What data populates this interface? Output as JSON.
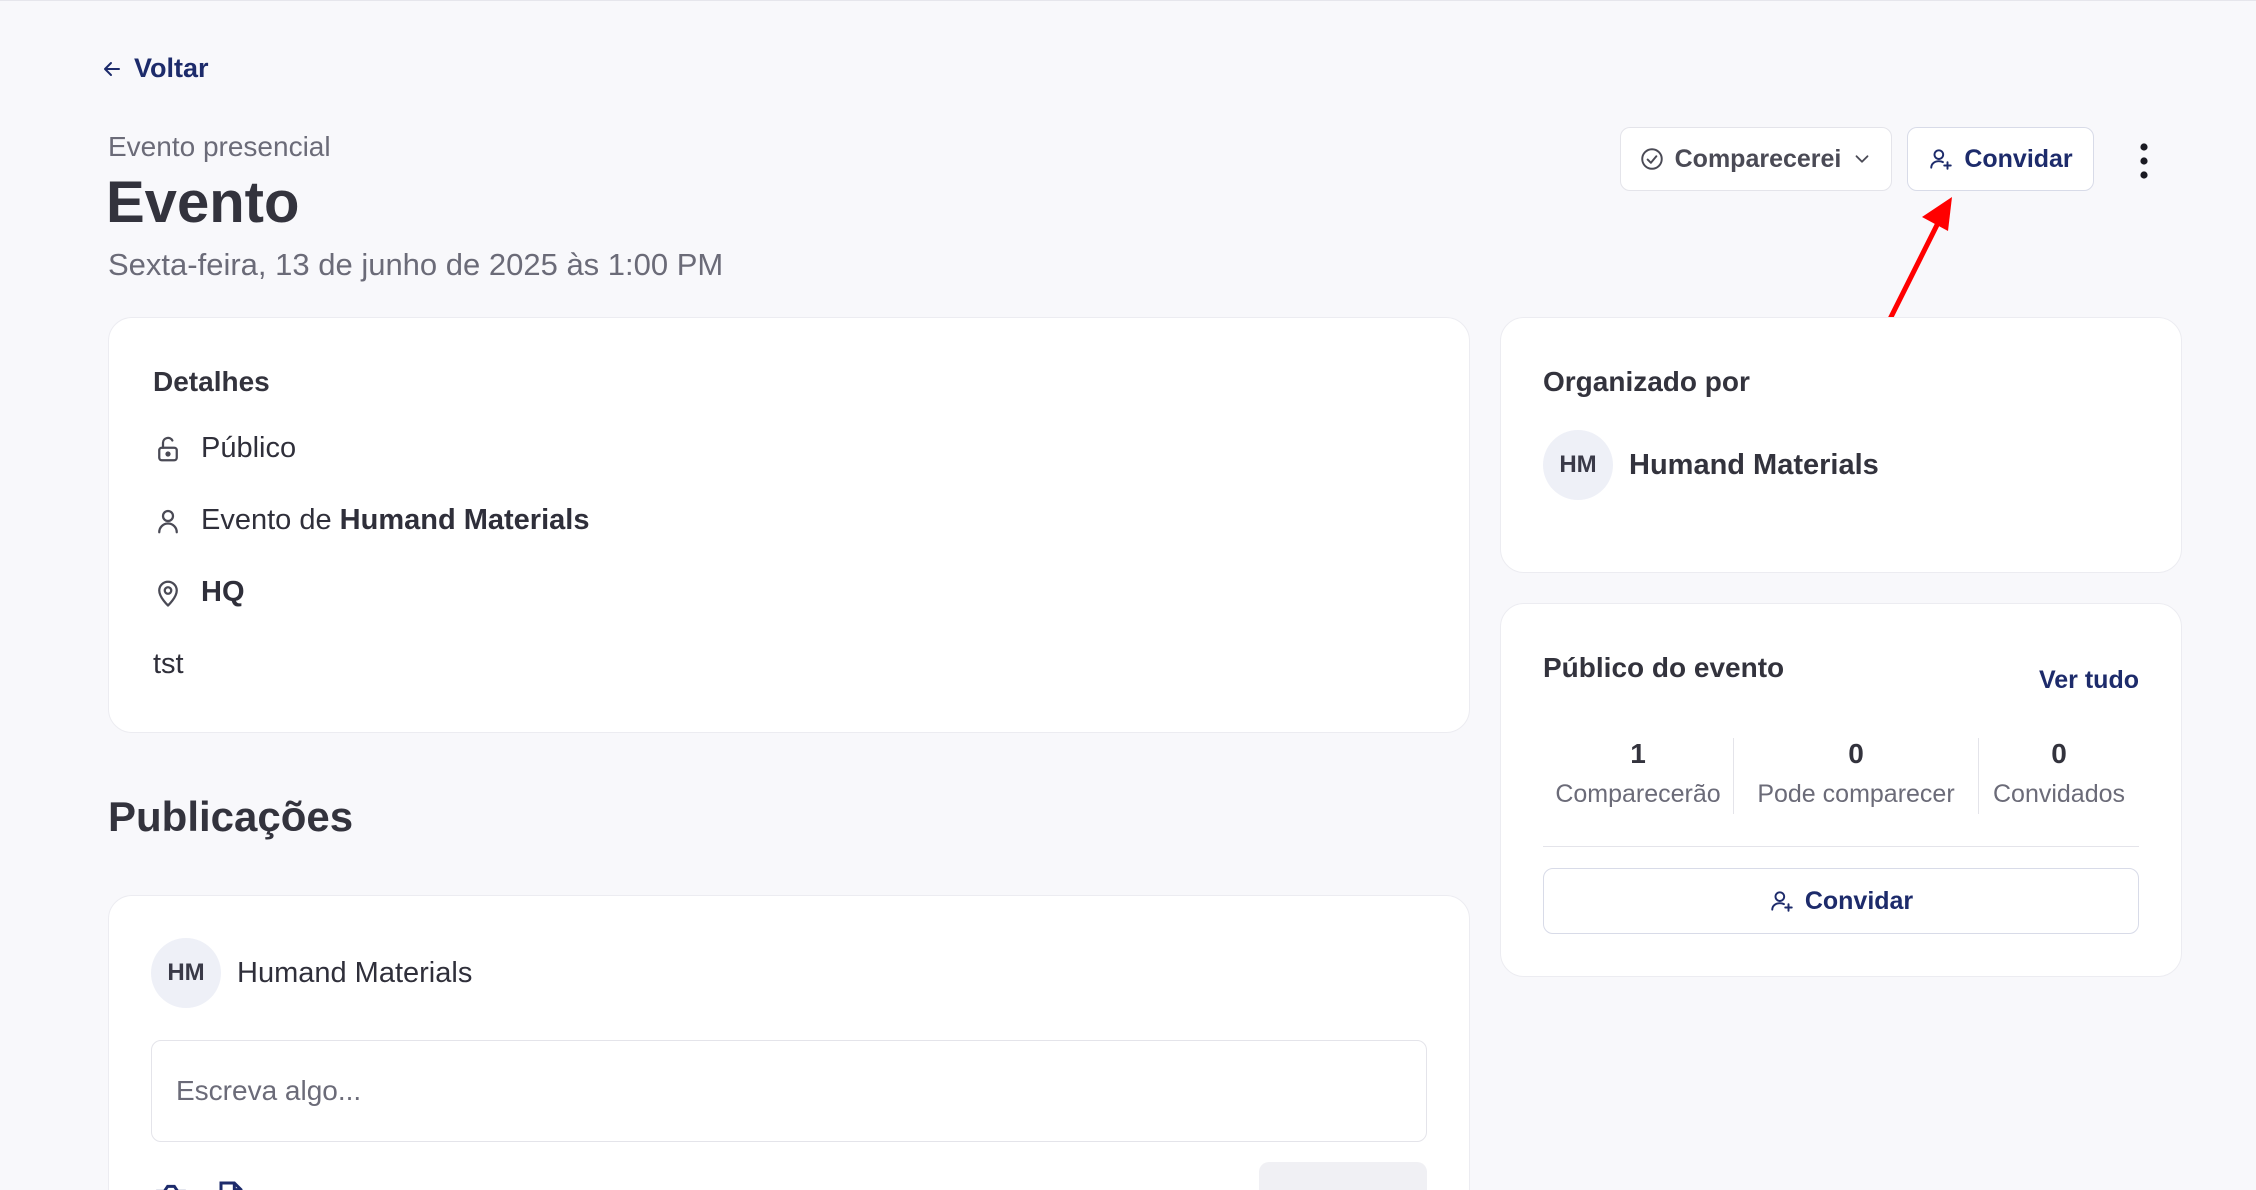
{
  "nav": {
    "back_label": "Voltar"
  },
  "event": {
    "type": "Evento presencial",
    "title": "Evento",
    "date": "Sexta-feira, 13 de junho de 2025 às 1:00 PM"
  },
  "actions": {
    "attend_label": "Comparecerei",
    "invite_label": "Convidar"
  },
  "details": {
    "heading": "Detalhes",
    "visibility": "Público",
    "organizer_prefix": "Evento de",
    "organizer_name": "Humand Materials",
    "location": "HQ",
    "description": "tst"
  },
  "organizer_card": {
    "heading": "Organizado por",
    "initials": "HM",
    "name": "Humand Materials"
  },
  "audience": {
    "heading": "Público do evento",
    "see_all": "Ver tudo",
    "stats": [
      {
        "value": "1",
        "label": "Comparecerão"
      },
      {
        "value": "0",
        "label": "Pode comparecer"
      },
      {
        "value": "0",
        "label": "Convidados"
      }
    ],
    "invite_label": "Convidar"
  },
  "publications": {
    "heading": "Publicações",
    "author_initials": "HM",
    "author_name": "Humand Materials",
    "input_placeholder": "Escreva algo..."
  },
  "colors": {
    "accent": "#1d2b6b",
    "annotation_arrow": "#ff0000",
    "background": "#f8f8fb"
  }
}
